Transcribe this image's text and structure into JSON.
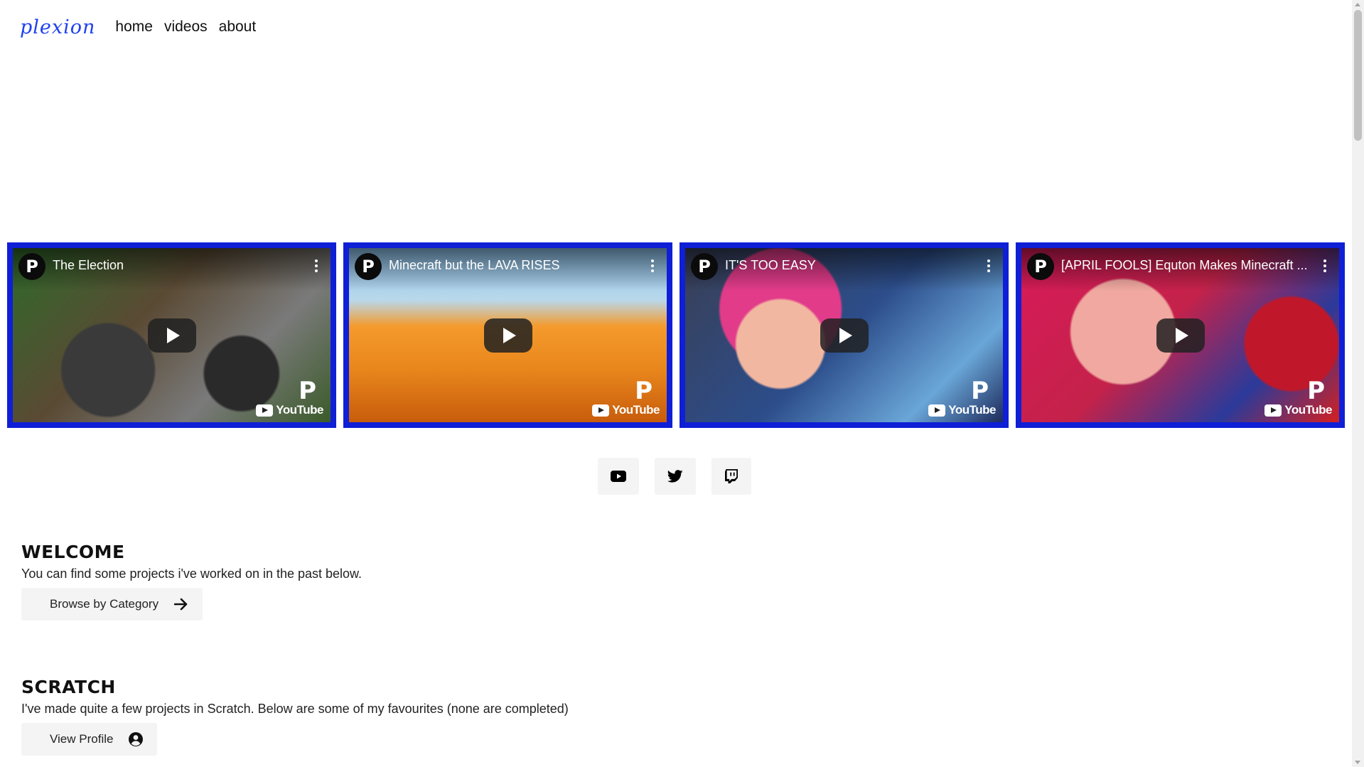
{
  "nav": {
    "logo": "plexion",
    "links": [
      "home",
      "videos",
      "about"
    ]
  },
  "videos": [
    {
      "title": "The Election",
      "channel_initial": "P"
    },
    {
      "title": "Minecraft but the LAVA RISES",
      "channel_initial": "P"
    },
    {
      "title": "IT'S TOO EASY",
      "channel_initial": "P"
    },
    {
      "title": "[APRIL FOOLS] Equton Makes Minecraft ...",
      "channel_initial": "P"
    }
  ],
  "video_brand": "YouTube",
  "socials": [
    {
      "icon": "youtube-icon"
    },
    {
      "icon": "twitter-icon"
    },
    {
      "icon": "twitch-icon"
    }
  ],
  "welcome": {
    "heading": "WELCOME",
    "text": "You can find some projects i've worked on in the past below.",
    "button": "Browse by Category"
  },
  "scratch": {
    "heading": "SCRATCH",
    "text": "I've made quite a few projects in Scratch. Below are some of my favourites (none are completed)",
    "button": "View Profile"
  },
  "colors": {
    "accent": "#1e40f0",
    "video_border": "#0f1fd6"
  }
}
